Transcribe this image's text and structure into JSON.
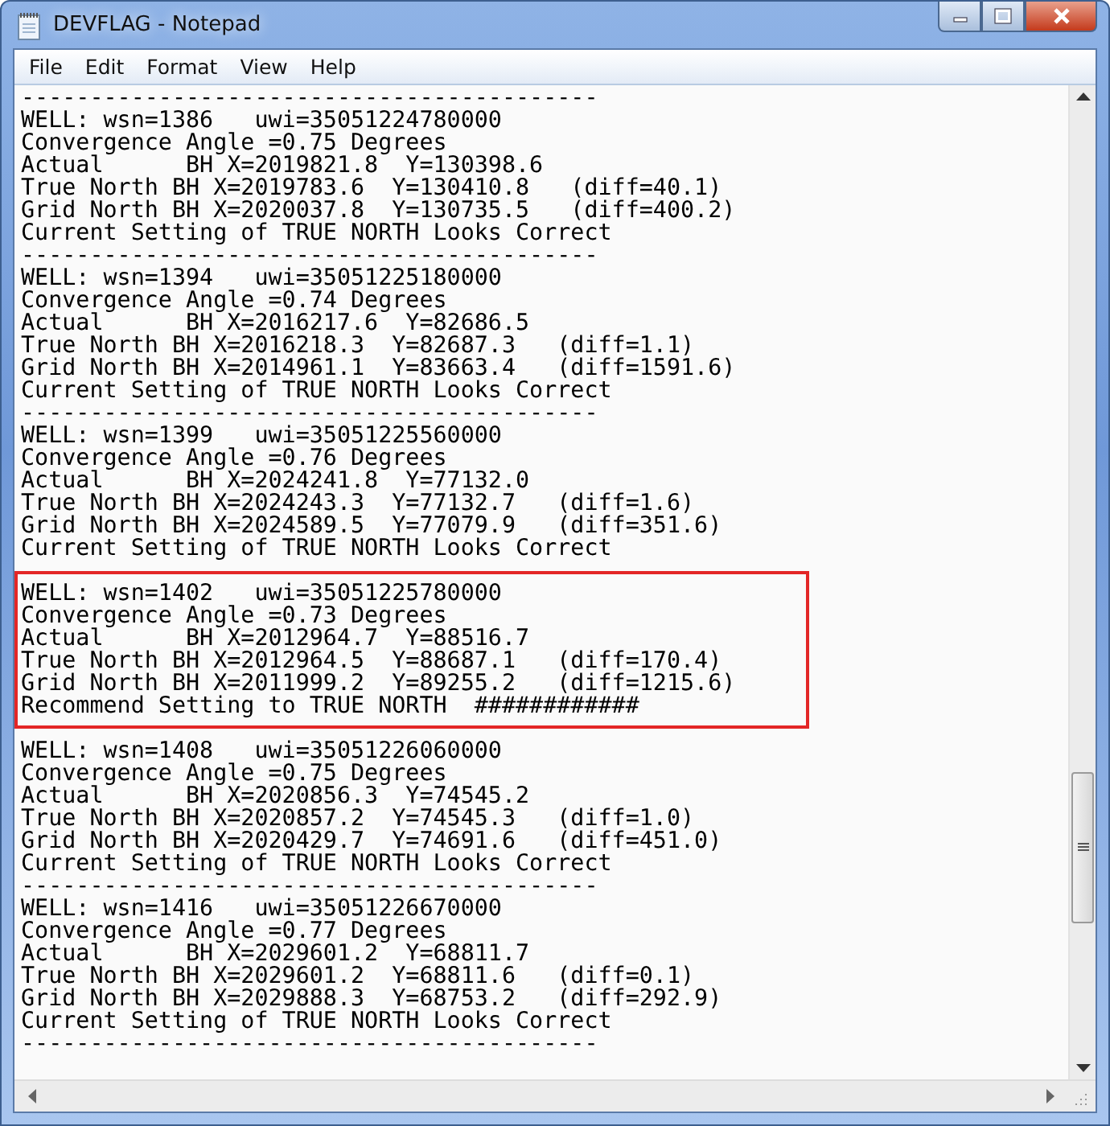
{
  "window": {
    "title": "DEVFLAG - Notepad"
  },
  "menu": [
    "File",
    "Edit",
    "Format",
    "View",
    "Help"
  ],
  "segments": [
    {
      "highlighted": false,
      "lines": [
        "------------------------------------------",
        "WELL: wsn=1386   uwi=35051224780000",
        "Convergence Angle =0.75 Degrees",
        "Actual      BH X=2019821.8  Y=130398.6",
        "True North BH X=2019783.6  Y=130410.8   (diff=40.1)",
        "Grid North BH X=2020037.8  Y=130735.5   (diff=400.2)",
        "Current Setting of TRUE NORTH Looks Correct",
        "------------------------------------------",
        "WELL: wsn=1394   uwi=35051225180000",
        "Convergence Angle =0.74 Degrees",
        "Actual      BH X=2016217.6  Y=82686.5",
        "True North BH X=2016218.3  Y=82687.3   (diff=1.1)",
        "Grid North BH X=2014961.1  Y=83663.4   (diff=1591.6)",
        "Current Setting of TRUE NORTH Looks Correct",
        "------------------------------------------",
        "WELL: wsn=1399   uwi=35051225560000",
        "Convergence Angle =0.76 Degrees",
        "Actual      BH X=2024241.8  Y=77132.0",
        "True North BH X=2024243.3  Y=77132.7   (diff=1.6)",
        "Grid North BH X=2024589.5  Y=77079.9   (diff=351.6)",
        "Current Setting of TRUE NORTH Looks Correct"
      ]
    },
    {
      "highlighted": true,
      "lines": [
        "WELL: wsn=1402   uwi=35051225780000",
        "Convergence Angle =0.73 Degrees",
        "Actual      BH X=2012964.7  Y=88516.7",
        "True North BH X=2012964.5  Y=88687.1   (diff=170.4)",
        "Grid North BH X=2011999.2  Y=89255.2   (diff=1215.6)",
        "Recommend Setting to TRUE NORTH  ############"
      ]
    },
    {
      "highlighted": false,
      "lines": [
        "WELL: wsn=1408   uwi=35051226060000",
        "Convergence Angle =0.75 Degrees",
        "Actual      BH X=2020856.3  Y=74545.2",
        "True North BH X=2020857.2  Y=74545.3   (diff=1.0)",
        "Grid North BH X=2020429.7  Y=74691.6   (diff=451.0)",
        "Current Setting of TRUE NORTH Looks Correct",
        "------------------------------------------",
        "WELL: wsn=1416   uwi=35051226670000",
        "Convergence Angle =0.77 Degrees",
        "Actual      BH X=2029601.2  Y=68811.7",
        "True North BH X=2029601.2  Y=68811.6   (diff=0.1)",
        "Grid North BH X=2029888.3  Y=68753.2   (diff=292.9)",
        "Current Setting of TRUE NORTH Looks Correct",
        "------------------------------------------"
      ]
    }
  ]
}
